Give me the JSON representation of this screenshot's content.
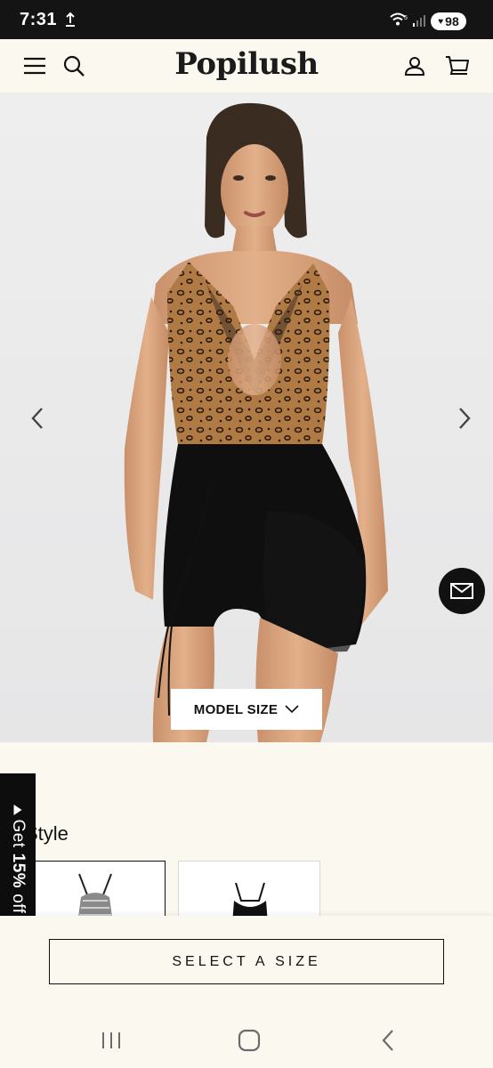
{
  "status_bar": {
    "time": "7:31",
    "battery": "98",
    "icons": [
      "upload-icon",
      "wifi-icon",
      "signal-icon",
      "battery-icon"
    ]
  },
  "header": {
    "brand": "Popilush",
    "icons": [
      "menu-icon",
      "search-icon",
      "account-icon",
      "cart-icon"
    ]
  },
  "hero": {
    "model_size_label": "MODEL SIZE",
    "icons": [
      "chevron-left-icon",
      "chevron-right-icon",
      "mail-icon",
      "chevron-down-icon"
    ]
  },
  "discount_tab": {
    "prefix": "Get",
    "percent": "15%",
    "suffix": "off"
  },
  "style_section": {
    "label": "Style"
  },
  "bottom_bar": {
    "select_size_label": "SELECT A SIZE"
  },
  "system_nav": {
    "icons": [
      "recent-apps-icon",
      "home-icon",
      "back-icon"
    ]
  },
  "colors": {
    "background": "#fbf9ef",
    "primary": "#111111",
    "status_bar": "#141414"
  }
}
